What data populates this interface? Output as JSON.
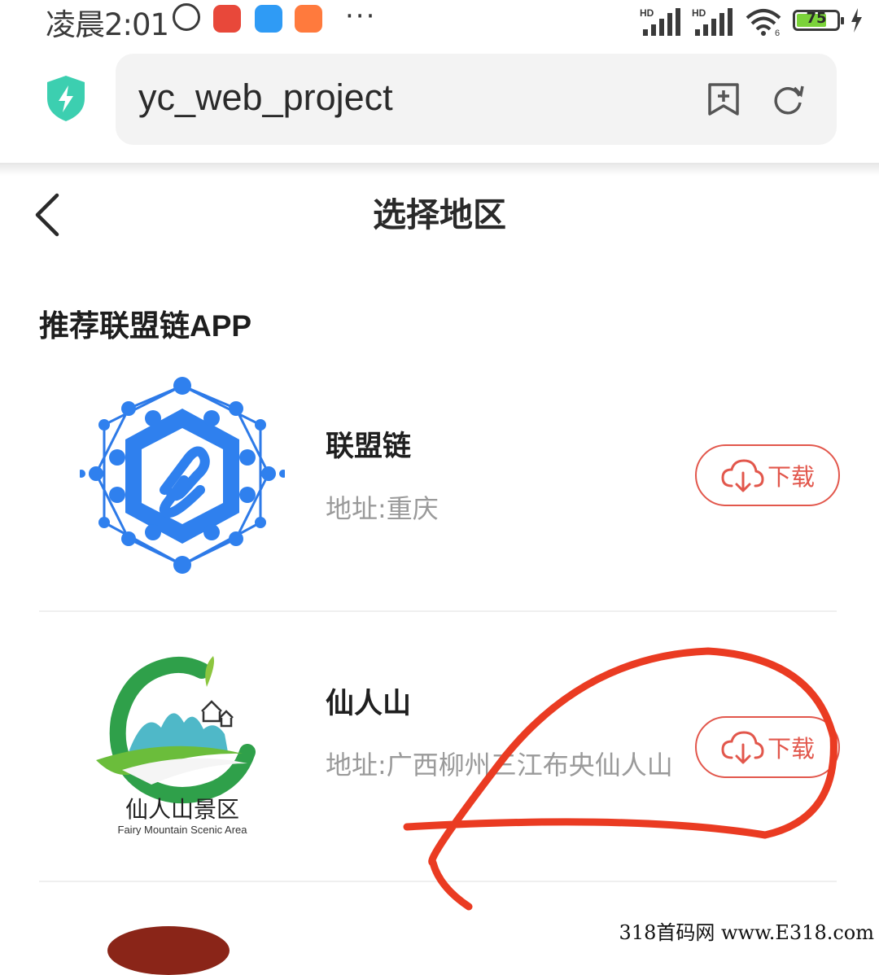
{
  "status_bar": {
    "time": "凌晨2:01",
    "dots": "···",
    "battery": "75",
    "battery_level_percent": 75,
    "signal_label_1": "HD",
    "signal_label_2": "HD",
    "wifi_label": "6"
  },
  "browser": {
    "url": "yc_web_project"
  },
  "page": {
    "title": "选择地区"
  },
  "section": {
    "title": "推荐联盟链APP"
  },
  "apps": [
    {
      "name": "联盟链",
      "address": "地址:重庆",
      "button": "下载",
      "icon": "hexagon-chain-logo"
    },
    {
      "name": "仙人山",
      "address": "地址:广西柳州三江布央仙人山",
      "button": "下载",
      "icon": "fairy-mountain-logo",
      "logo_cn_text": "仙人山景区",
      "logo_en_text": "Fairy Mountain Scenic Area"
    }
  ],
  "watermark": "318首码网 www.E318.com",
  "colors": {
    "accent": "#e2574c",
    "scribble": "#ea3b22",
    "shield": "#3ccfb0"
  }
}
